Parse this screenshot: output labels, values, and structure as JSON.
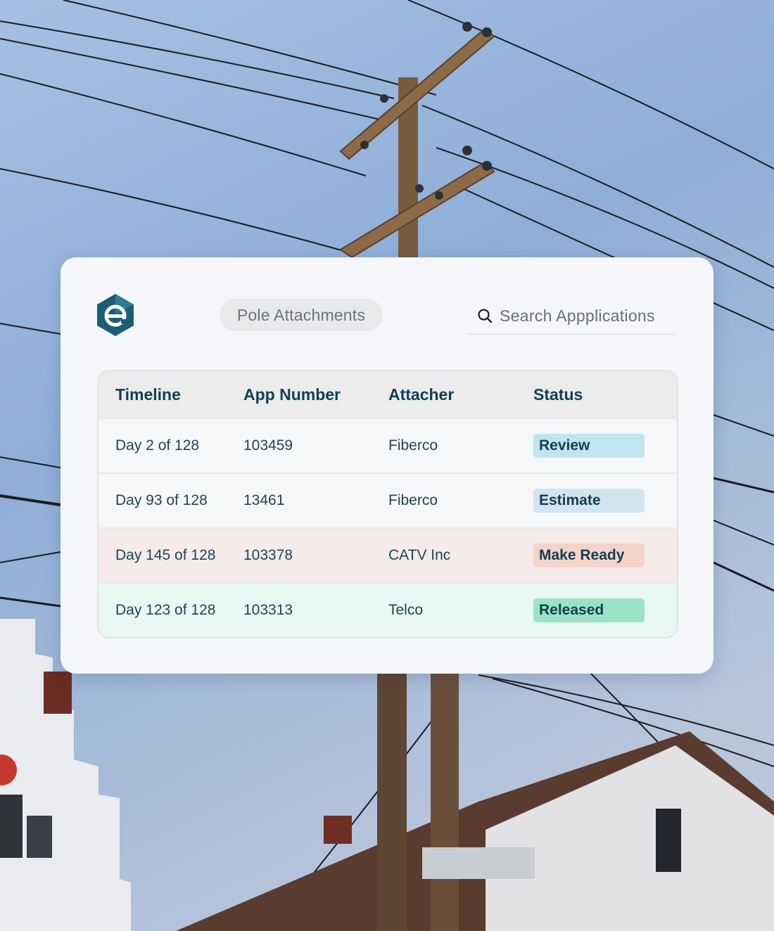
{
  "colors": {
    "brand": "#1b5e74",
    "header_text": "#123f52",
    "review_badge": "#bfe6ee",
    "estimate_badge": "#d3e5f0",
    "make_ready_badge": "#f5d3ca",
    "released_badge": "#9be3c6",
    "make_ready_row": "#f5ebea",
    "released_row": "#e8f8f2"
  },
  "header": {
    "logo_icon": "hexagon-e-logo-icon",
    "section_pill": "Pole Attachments",
    "search": {
      "icon": "search-icon",
      "placeholder": "Search Appplications"
    }
  },
  "table": {
    "columns": [
      "Timeline",
      "App Number",
      "Attacher",
      "Status"
    ],
    "rows": [
      {
        "timeline": "Day 2 of 128",
        "app_number": "103459",
        "attacher": "Fiberco",
        "status": "Review"
      },
      {
        "timeline": "Day 93 of 128",
        "app_number": "13461",
        "attacher": "Fiberco",
        "status": "Estimate"
      },
      {
        "timeline": "Day 145 of 128",
        "app_number": "103378",
        "attacher": "CATV Inc",
        "status": "Make Ready"
      },
      {
        "timeline": "Day 123 of 128",
        "app_number": "103313",
        "attacher": "Telco",
        "status": "Released"
      }
    ]
  }
}
